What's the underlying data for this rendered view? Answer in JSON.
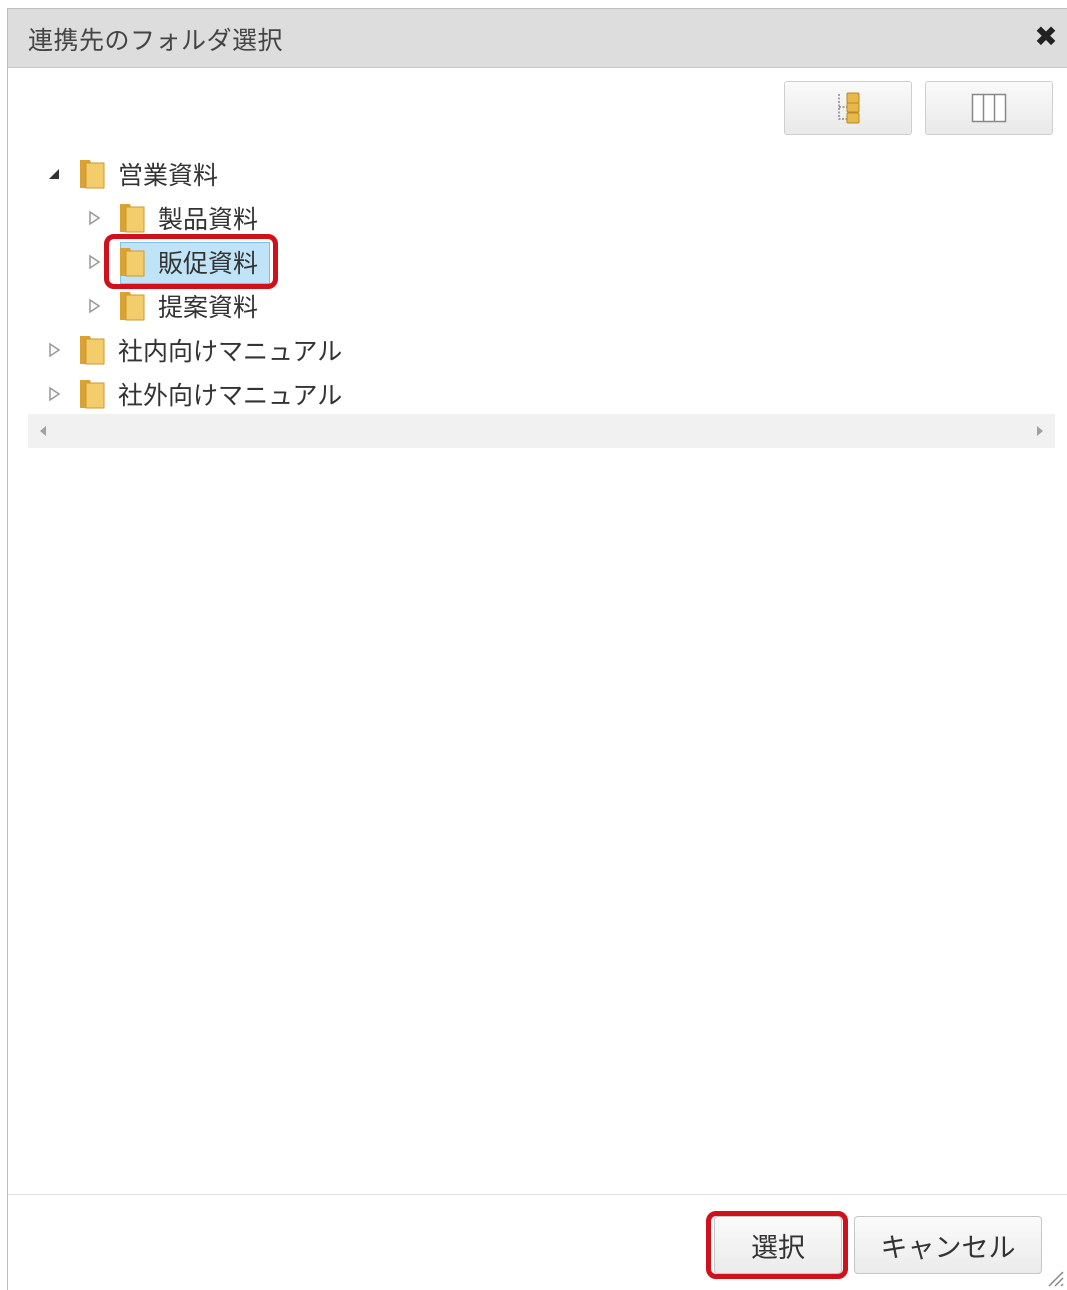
{
  "dialog": {
    "title": "連携先のフォルダ選択",
    "close_icon": "close-icon"
  },
  "toolbar": {
    "tree_view_icon": "tree-view-icon",
    "column_view_icon": "column-view-icon"
  },
  "tree": {
    "nodes": [
      {
        "label": "営業資料",
        "expanded": true,
        "level": 0
      },
      {
        "label": "製品資料",
        "expanded": false,
        "level": 1
      },
      {
        "label": "販促資料",
        "expanded": false,
        "level": 1,
        "selected": true
      },
      {
        "label": "提案資料",
        "expanded": false,
        "level": 1
      },
      {
        "label": "社内向けマニュアル",
        "expanded": false,
        "level": 0
      },
      {
        "label": "社外向けマニュアル",
        "expanded": false,
        "level": 0
      }
    ]
  },
  "footer": {
    "select_label": "選択",
    "cancel_label": "キャンセル"
  },
  "colors": {
    "highlight": "#d0101a",
    "selected": "#bfe3f7",
    "folder": "#e8b84a"
  }
}
